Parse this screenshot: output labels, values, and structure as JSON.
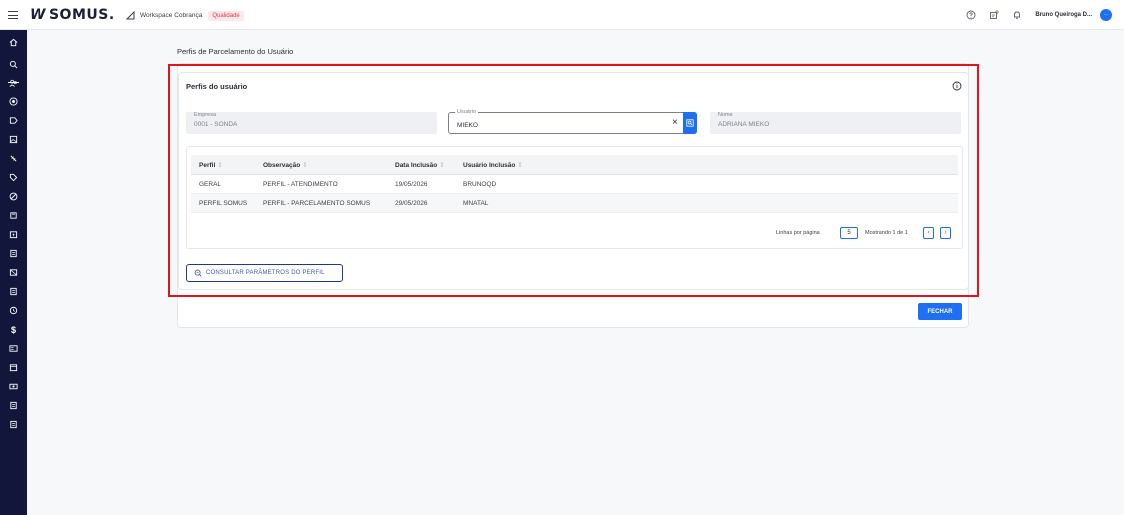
{
  "header": {
    "logo_text": "SOMUS.",
    "logo_mark": "W",
    "workspace_label": "Workspace Cobrança",
    "environment_badge": "Qualidade",
    "user_name": "Bruno Queiroga D...",
    "avatar_initial": "··",
    "icons": [
      "help-icon",
      "notification-settings-icon",
      "bell-icon"
    ]
  },
  "sidebar": {
    "icons": [
      "home-icon",
      "search-icon",
      "users-icon",
      "circle-plus-icon",
      "forward-icon",
      "image-icon",
      "slash-icon",
      "tag-icon",
      "ban-icon",
      "copy-icon",
      "calendar-icon",
      "document-icon",
      "unlink-icon",
      "document-icon",
      "history-icon",
      "dollar-icon",
      "id-card-icon",
      "calendar-check-icon",
      "money-icon",
      "list-icon",
      "list-icon"
    ]
  },
  "page": {
    "title": "Perfis de Parcelamento do Usuário"
  },
  "card": {
    "title": "Perfis do usuário",
    "fields": {
      "empresa": {
        "label": "Empresa",
        "value": "0001 - SONDA"
      },
      "usuario": {
        "label": "Usuário",
        "value": "MIEKO"
      },
      "nome": {
        "label": "Nome",
        "value": "ADRIANA MIEKO"
      }
    },
    "table": {
      "columns": [
        "Perfil",
        "Observação",
        "Data Inclusão",
        "Usuário Inclusão"
      ],
      "rows": [
        [
          "GERAL",
          "PERFIL - ATENDIMENTO",
          "19/05/2026",
          "BRUNOQD"
        ],
        [
          "PERFIL SOMUS",
          "PERFIL - PARCELAMENTO SOMUS",
          "29/05/2026",
          "MNATAL"
        ]
      ]
    },
    "pagination": {
      "rows_per_page_label": "Linhas por página",
      "rows_per_page": "5",
      "showing": "Mostrando 1 de 1",
      "prev": "‹",
      "next": "›"
    },
    "consult_button": "CONSULTAR PARÂMETROS DO PERFIL"
  },
  "footer": {
    "close_button": "FECHAR"
  },
  "colors": {
    "brand_dark": "#11163a",
    "accent": "#1f6ff2",
    "highlight": "#e1141e"
  }
}
